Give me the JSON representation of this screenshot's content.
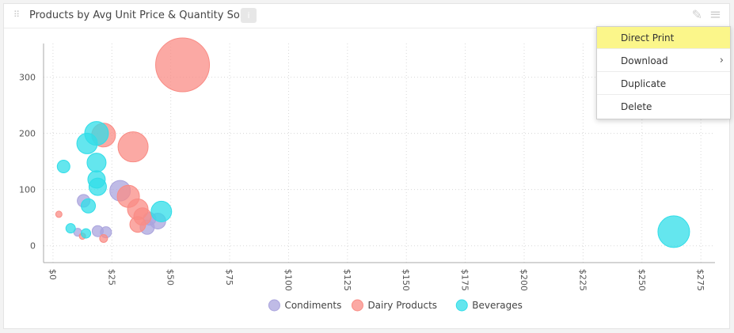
{
  "widget": {
    "title": "Products by Avg Unit Price & Quantity Sold",
    "info_icon": "info-icon",
    "edit_icon": "pencil-icon",
    "menu_icon": "hamburger-menu-icon"
  },
  "menu": {
    "items": [
      {
        "label": "Direct Print",
        "active": true
      },
      {
        "label": "Download",
        "submenu": true
      },
      {
        "label": "Duplicate"
      },
      {
        "label": "Delete"
      }
    ]
  },
  "chart_data": {
    "type": "bubble",
    "xlabel": "",
    "ylabel": "",
    "xlim": [
      -4,
      281
    ],
    "ylim": [
      -30,
      360
    ],
    "x_ticks": [
      0,
      25,
      50,
      75,
      100,
      125,
      150,
      175,
      200,
      225,
      250,
      275
    ],
    "x_tick_labels": [
      "$0",
      "$25",
      "$50",
      "$75",
      "$100",
      "$125",
      "$150",
      "$175",
      "$200",
      "$225",
      "$250",
      "$275"
    ],
    "y_ticks": [
      0,
      100,
      200,
      300
    ],
    "y_tick_labels": [
      "0",
      "100",
      "200",
      "300"
    ],
    "grid": true,
    "legend_position": "bottom",
    "colors": {
      "Condiments": "#aaa4dd",
      "Dairy Products": "#f98c85",
      "Beverages": "#30dde8"
    },
    "series": [
      {
        "name": "Condiments",
        "points": [
          {
            "x": 13,
            "y": 80,
            "size": 8
          },
          {
            "x": 28.5,
            "y": 98,
            "size": 13
          },
          {
            "x": 19,
            "y": 26,
            "size": 7
          },
          {
            "x": 22.5,
            "y": 24,
            "size": 7
          },
          {
            "x": 10.5,
            "y": 24,
            "size": 5
          },
          {
            "x": 40,
            "y": 33,
            "size": 9
          },
          {
            "x": 44.5,
            "y": 44,
            "size": 10
          },
          {
            "x": 41,
            "y": 48,
            "size": 8
          }
        ]
      },
      {
        "name": "Dairy Products",
        "points": [
          {
            "x": 2.5,
            "y": 56,
            "size": 4
          },
          {
            "x": 12.5,
            "y": 17,
            "size": 4
          },
          {
            "x": 21.5,
            "y": 13,
            "size": 5
          },
          {
            "x": 21.5,
            "y": 197,
            "size": 15
          },
          {
            "x": 34,
            "y": 176,
            "size": 19
          },
          {
            "x": 32,
            "y": 88,
            "size": 14
          },
          {
            "x": 36,
            "y": 65,
            "size": 13
          },
          {
            "x": 38,
            "y": 52,
            "size": 11
          },
          {
            "x": 36,
            "y": 38,
            "size": 10
          },
          {
            "x": 55,
            "y": 322,
            "size": 34
          }
        ]
      },
      {
        "name": "Beverages",
        "points": [
          {
            "x": 4.5,
            "y": 141,
            "size": 8
          },
          {
            "x": 7.5,
            "y": 31,
            "size": 6
          },
          {
            "x": 14,
            "y": 22,
            "size": 6
          },
          {
            "x": 15,
            "y": 71,
            "size": 9
          },
          {
            "x": 14.5,
            "y": 182,
            "size": 13
          },
          {
            "x": 18.5,
            "y": 200,
            "size": 15
          },
          {
            "x": 18.5,
            "y": 148,
            "size": 12
          },
          {
            "x": 18.5,
            "y": 118,
            "size": 11
          },
          {
            "x": 19,
            "y": 105,
            "size": 11
          },
          {
            "x": 46,
            "y": 61,
            "size": 13
          },
          {
            "x": 263.5,
            "y": 25,
            "size": 20
          }
        ]
      }
    ]
  }
}
